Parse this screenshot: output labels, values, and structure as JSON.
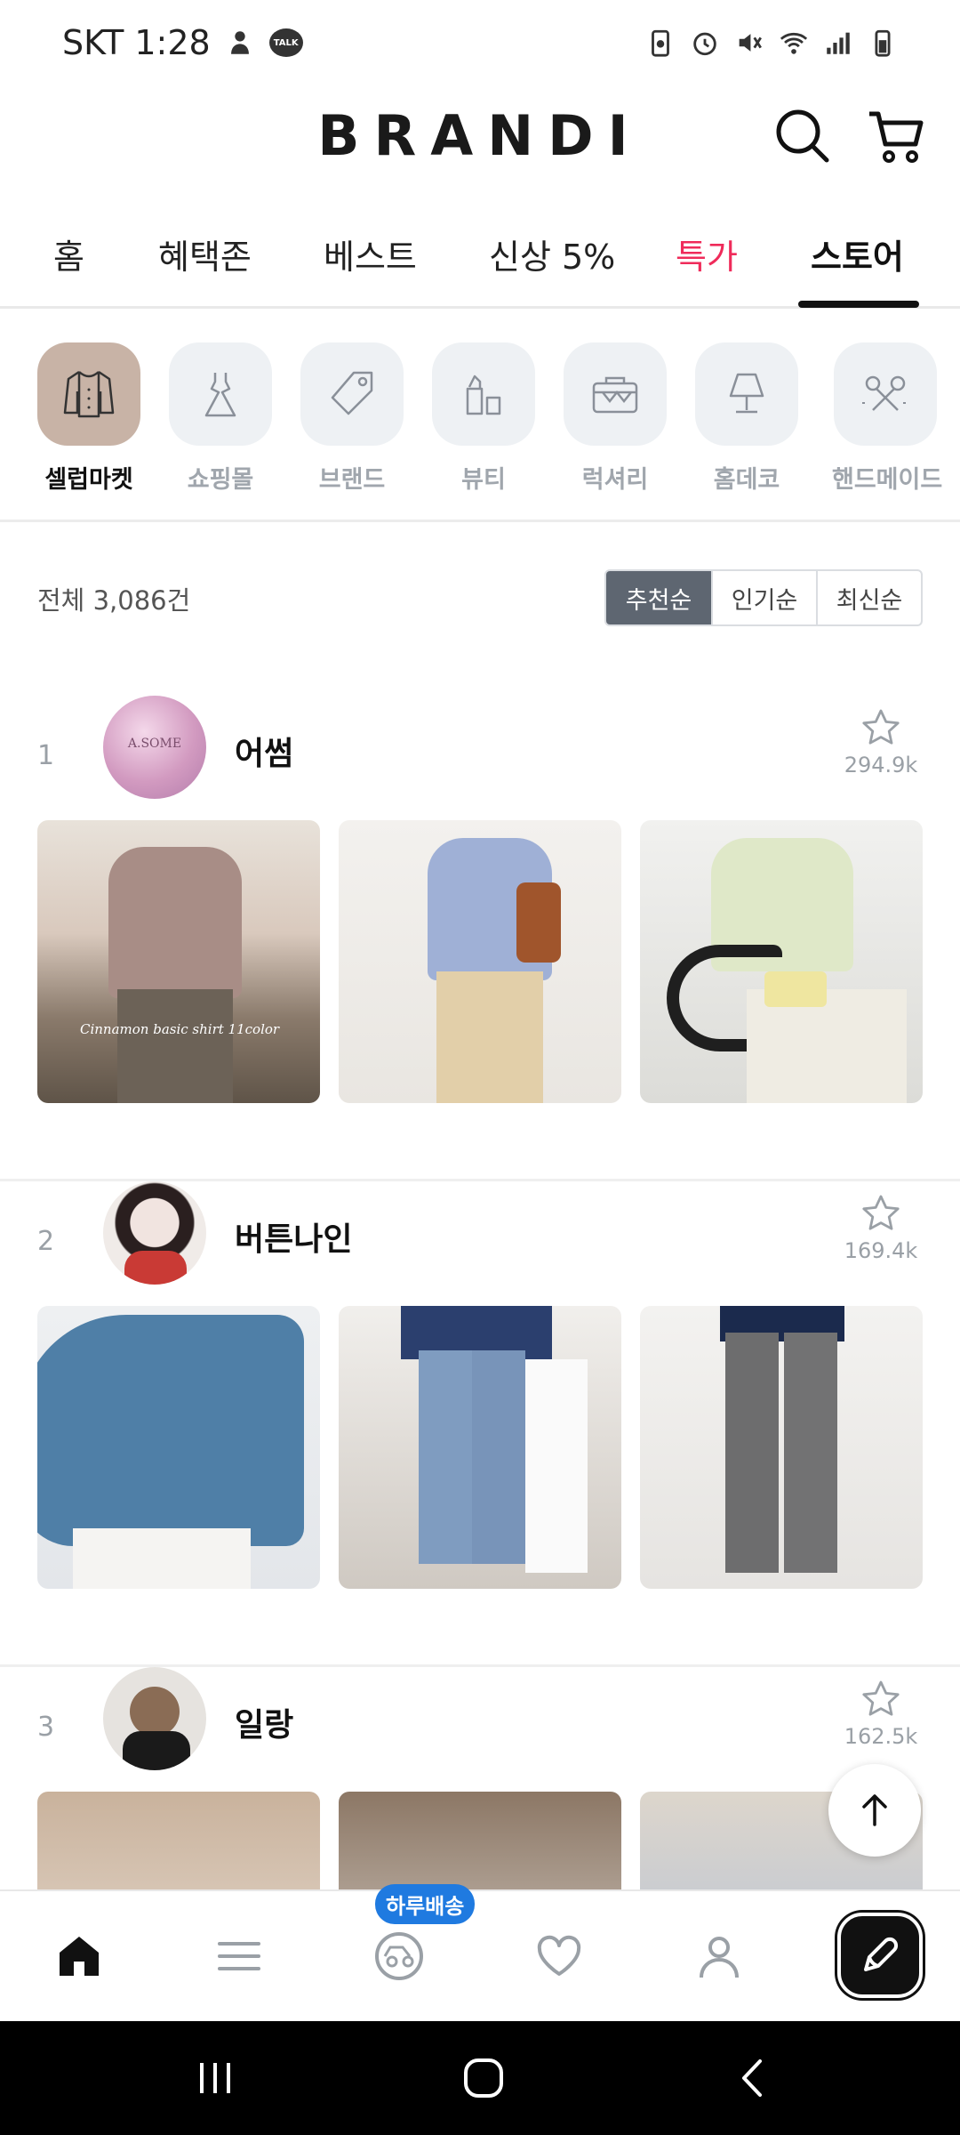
{
  "status_bar": {
    "carrier_time": "SKT 1:28",
    "talk_badge": "TALK",
    "icons": [
      "person-icon",
      "talk-icon",
      "battery-saver-icon",
      "alarm-icon",
      "mute-icon",
      "wifi-icon",
      "signal-icon",
      "battery-icon"
    ]
  },
  "header": {
    "logo": "BRANDI",
    "search_icon": "search-icon",
    "cart_icon": "cart-icon"
  },
  "tabs": [
    {
      "label": "홈"
    },
    {
      "label": "혜택존"
    },
    {
      "label": "베스트"
    },
    {
      "label": "신상 5%"
    },
    {
      "label": "특가",
      "color": "#ef2b5a"
    },
    {
      "label": "스토어",
      "active": true
    }
  ],
  "categories": [
    {
      "label": "셀럽마켓",
      "icon": "jacket-icon",
      "active": true
    },
    {
      "label": "쇼핑몰",
      "icon": "dress-icon"
    },
    {
      "label": "브랜드",
      "icon": "tag-icon"
    },
    {
      "label": "뷰티",
      "icon": "lipstick-icon"
    },
    {
      "label": "럭셔리",
      "icon": "bag-icon"
    },
    {
      "label": "홈데코",
      "icon": "lamp-icon"
    },
    {
      "label": "핸드메이드",
      "icon": "scissors-icon"
    }
  ],
  "list": {
    "total": "전체 3,086건",
    "sort_options": [
      {
        "label": "추천순",
        "active": true
      },
      {
        "label": "인기순"
      },
      {
        "label": "최신순"
      }
    ]
  },
  "stores": [
    {
      "rank": "1",
      "name": "어썸",
      "favorites": "294.9k",
      "avatar_text": "A.SOME",
      "thumb_caption": "Cinnamon basic shirt 11color"
    },
    {
      "rank": "2",
      "name": "버튼나인",
      "favorites": "169.4k"
    },
    {
      "rank": "3",
      "name": "일랑",
      "favorites": "162.5k"
    }
  ],
  "bottom_nav": {
    "items": [
      "home-icon",
      "menu-icon",
      "delivery-icon",
      "heart-icon",
      "profile-icon"
    ],
    "badge": "하루배송",
    "fab_icon": "feed-icon"
  },
  "colors": {
    "accent_red": "#ef2b5a",
    "sort_active": "#5e6671",
    "badge_blue": "#1f7ae0",
    "active_chip": "#c8b3a6"
  }
}
